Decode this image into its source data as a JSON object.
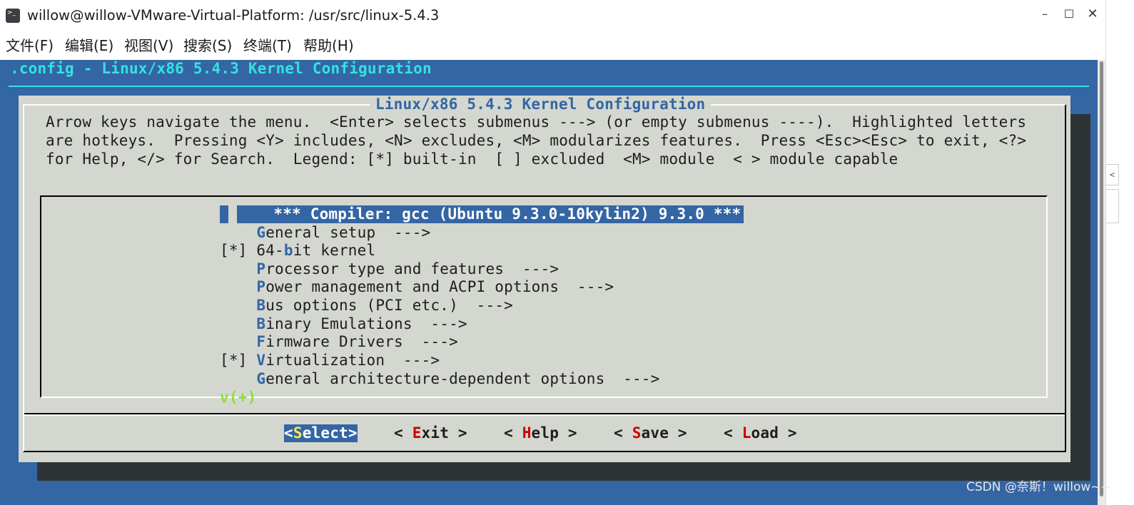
{
  "window": {
    "title": "willow@willow-VMware-Virtual-Platform: /usr/src/linux-5.4.3",
    "icon": "terminal-icon",
    "controls": {
      "minimize": "–",
      "maximize": "☐",
      "close": "✕"
    }
  },
  "menubar": {
    "items": [
      {
        "label": "文件(F)"
      },
      {
        "label": "编辑(E)"
      },
      {
        "label": "视图(V)"
      },
      {
        "label": "搜索(S)"
      },
      {
        "label": "终端(T)"
      },
      {
        "label": "帮助(H)"
      }
    ]
  },
  "terminal": {
    "config_title": ".config - Linux/x86 5.4.3 Kernel Configuration",
    "dialog_title": "Linux/x86 5.4.3 Kernel Configuration",
    "help_lines": [
      "Arrow keys navigate the menu.  <Enter> selects submenus ---> (or empty submenus ----).  Highlighted letters",
      "are hotkeys.  Pressing <Y> includes, <N> excludes, <M> modularizes features.  Press <Esc><Esc> to exit, <?>",
      "for Help, </> for Search.  Legend: [*] built-in  [ ] excluded  <M> module  < > module capable"
    ],
    "entries": [
      {
        "prefix": "",
        "hotkey": "",
        "rest": "*** Compiler: gcc (Ubuntu 9.3.0-10kylin2) 9.3.0 ***",
        "selected": true
      },
      {
        "prefix": "    ",
        "hotkey": "G",
        "rest": "eneral setup  --->"
      },
      {
        "prefix": "[*] ",
        "hotkey": "",
        "rest": "64-bit kernel"
      },
      {
        "prefix": "    ",
        "hotkey": "P",
        "rest": "rocessor type and features  --->"
      },
      {
        "prefix": "    ",
        "hotkey": "P",
        "rest": "ower management and ACPI options  --->"
      },
      {
        "prefix": "    ",
        "hotkey": "B",
        "rest": "us options (PCI etc.)  --->"
      },
      {
        "prefix": "    ",
        "hotkey": "B",
        "rest": "inary Emulations  --->"
      },
      {
        "prefix": "    ",
        "hotkey": "F",
        "rest": "irmware Drivers  --->"
      },
      {
        "prefix": "[*] ",
        "hotkey": "V",
        "rest": "irtualization  --->"
      },
      {
        "prefix": "    ",
        "hotkey": "G",
        "rest": "eneral architecture-dependent options  --->"
      }
    ],
    "entry2_pre": "[*] 64-",
    "entry2_hk": "b",
    "entry2_post": "it kernel",
    "scroll_indicator": "v(+)",
    "buttons": [
      {
        "open": "<",
        "hotkey": "S",
        "rest": "elect",
        "close": ">"
      },
      {
        "open": "< ",
        "hotkey": "E",
        "rest": "xit",
        "close": " >"
      },
      {
        "open": "< ",
        "hotkey": "H",
        "rest": "elp",
        "close": " >"
      },
      {
        "open": "< ",
        "hotkey": "S",
        "rest": "ave",
        "close": " >"
      },
      {
        "open": "< ",
        "hotkey": "L",
        "rest": "oad",
        "close": " >"
      }
    ]
  },
  "watermark": "CSDN @奈斯！willow~~",
  "colors": {
    "terminal_bg": "#3465a4",
    "dialog_bg": "#d3d7cf",
    "title_cyan": "#34e2e2",
    "hotkey_blue": "#3465a4",
    "button_hotkey_red": "#cc0000",
    "selected_hotkey_yellow": "#fce94f",
    "more_green": "#8ae234"
  }
}
